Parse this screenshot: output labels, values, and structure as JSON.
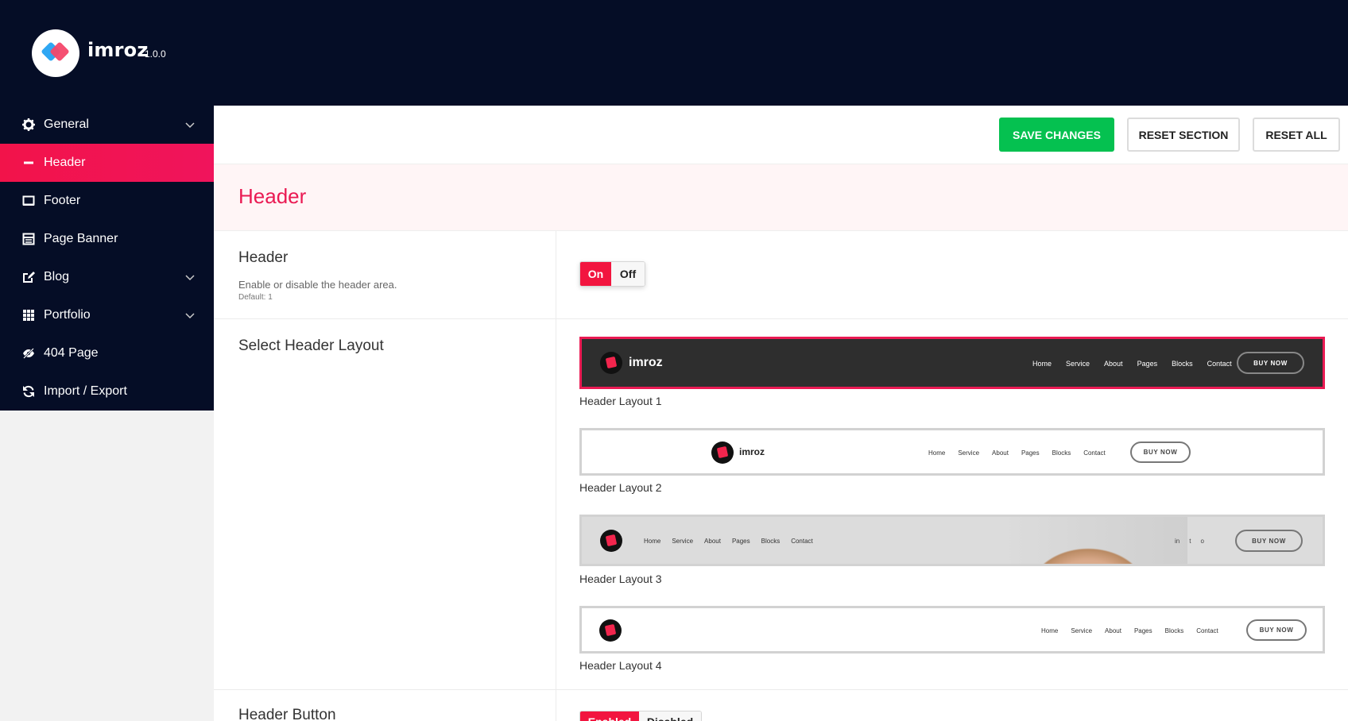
{
  "app": {
    "brand": "imroz",
    "version": "1.0.0"
  },
  "sidebar": {
    "items": [
      {
        "label": "General",
        "icon": "gear-icon",
        "has_chevron": true
      },
      {
        "label": "Header",
        "icon": "minus-icon",
        "active": true
      },
      {
        "label": "Footer",
        "icon": "monitor-icon"
      },
      {
        "label": "Page Banner",
        "icon": "table-icon"
      },
      {
        "label": "Blog",
        "icon": "edit-icon",
        "has_chevron": true
      },
      {
        "label": "Portfolio",
        "icon": "grid-icon",
        "has_chevron": true
      },
      {
        "label": "404 Page",
        "icon": "eye-slash-icon"
      },
      {
        "label": "Import / Export",
        "icon": "refresh-icon"
      }
    ]
  },
  "toolbar": {
    "save_label": "SAVE CHANGES",
    "reset_section_label": "RESET SECTION",
    "reset_all_label": "RESET ALL"
  },
  "section": {
    "title": "Header"
  },
  "fields": {
    "header": {
      "title": "Header",
      "description": "Enable or disable the header area.",
      "default": "Default: 1",
      "on_label": "On",
      "off_label": "Off",
      "value": "On"
    },
    "layout": {
      "title": "Select Header Layout",
      "selected": "Header Layout 1",
      "options": [
        {
          "caption": "Header Layout 1"
        },
        {
          "caption": "Header Layout 2"
        },
        {
          "caption": "Header Layout 3"
        },
        {
          "caption": "Header Layout 4"
        }
      ],
      "preview": {
        "brand": "imroz",
        "nav": [
          "Home",
          "Service",
          "About",
          "Pages",
          "Blocks",
          "Contact"
        ],
        "button": "BUY NOW",
        "social": [
          "in",
          "t",
          "o"
        ]
      }
    },
    "header_button": {
      "title": "Header Button",
      "enabled_label": "Enabled",
      "disabled_label": "Disabled"
    }
  },
  "colors": {
    "accent": "#ea1a53",
    "save": "#05c150",
    "sidebar_bg": "#050d26"
  }
}
